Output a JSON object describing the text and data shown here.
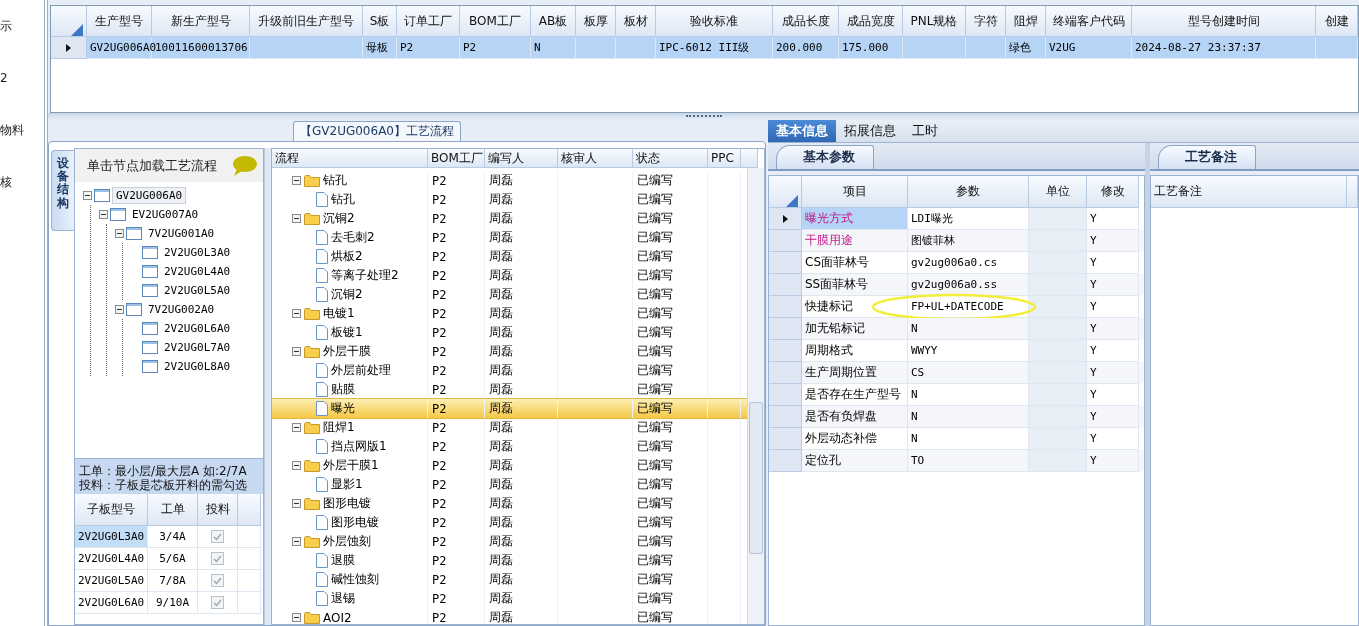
{
  "side_nav": {
    "items": [
      "示",
      "2",
      "物料",
      "核"
    ]
  },
  "product_grid": {
    "columns": [
      "生产型号",
      "新生产型号",
      "升级前旧生产型号",
      "S板",
      "订单工厂",
      "BOM工厂",
      "AB板",
      "板厚",
      "板材",
      "验收标准",
      "成品长度",
      "成品宽度",
      "PNL规格",
      "字符",
      "阻焊",
      "终端客户代码",
      "型号创建时间",
      "创建"
    ],
    "rows": [
      {
        "selected": true,
        "cells": [
          "GV2UG006A0",
          "10011600013706",
          null,
          "母板",
          "P2",
          "P2",
          "N",
          null,
          null,
          "IPC-6012 III级",
          "200.000",
          "175.000",
          null,
          null,
          "绿色",
          "V2UG",
          "2024-08-27 23:37:37",
          null
        ]
      }
    ]
  },
  "flow_panel": {
    "title": "【GV2UG006A0】工艺流程",
    "side_tab": "设备结构",
    "tree_header": "单击节点加载工艺流程",
    "device_tree": [
      {
        "label": "GV2UG006A0",
        "selected": true,
        "expanded": true,
        "children": [
          {
            "label": "EV2UG007A0",
            "selected": false,
            "expanded": true,
            "children": [
              {
                "label": "7V2UG001A0",
                "selected": false,
                "expanded": true,
                "children": [
                  {
                    "label": "2V2UG0L3A0",
                    "selected": false
                  },
                  {
                    "label": "2V2UG0L4A0",
                    "selected": false
                  },
                  {
                    "label": "2V2UG0L5A0",
                    "selected": false
                  }
                ]
              },
              {
                "label": "7V2UG002A0",
                "selected": false,
                "expanded": true,
                "children": [
                  {
                    "label": "2V2UG0L6A0",
                    "selected": false
                  },
                  {
                    "label": "2V2UG0L7A0",
                    "selected": false
                  },
                  {
                    "label": "2V2UG0L8A0",
                    "selected": false
                  }
                ]
              }
            ]
          }
        ]
      }
    ],
    "notes": [
      "工单：最小层/最大层A 如:2/7A",
      "投料：子板是芯板开料的需勾选"
    ],
    "sub_grid": {
      "columns": [
        "子板型号",
        "工单",
        "投料"
      ],
      "rows": [
        {
          "part_no": "2V2UG0L3A0",
          "work_order": "3/4A",
          "checked": true,
          "selected": true
        },
        {
          "part_no": "2V2UG0L4A0",
          "work_order": "5/6A",
          "checked": true,
          "selected": false
        },
        {
          "part_no": "2V2UG0L5A0",
          "work_order": "7/8A",
          "checked": true,
          "selected": false
        },
        {
          "part_no": "2V2UG0L6A0",
          "work_order": "9/10A",
          "checked": true,
          "selected": false
        }
      ]
    },
    "process_grid": {
      "columns": [
        "流程",
        "BOM工厂",
        "编写人",
        "核审人",
        "状态",
        "PPC"
      ],
      "steps": [
        {
          "name": "钻孔",
          "bom_factory": "P2",
          "author": "周磊",
          "status": "已编写",
          "selected": false,
          "expanded": true,
          "children": [
            {
              "name": "钻孔",
              "bom_factory": "P2",
              "author": "周磊",
              "status": "已编写",
              "selected": false
            }
          ]
        },
        {
          "name": "沉铜2",
          "bom_factory": "P2",
          "author": "周磊",
          "status": "已编写",
          "selected": false,
          "expanded": true,
          "children": [
            {
              "name": "去毛刺2",
              "bom_factory": "P2",
              "author": "周磊",
              "status": "已编写",
              "selected": false
            },
            {
              "name": "烘板2",
              "bom_factory": "P2",
              "author": "周磊",
              "status": "已编写",
              "selected": false
            },
            {
              "name": "等离子处理2",
              "bom_factory": "P2",
              "author": "周磊",
              "status": "已编写",
              "selected": false
            },
            {
              "name": "沉铜2",
              "bom_factory": "P2",
              "author": "周磊",
              "status": "已编写",
              "selected": false
            }
          ]
        },
        {
          "name": "电镀1",
          "bom_factory": "P2",
          "author": "周磊",
          "status": "已编写",
          "selected": false,
          "expanded": true,
          "children": [
            {
              "name": "板镀1",
              "bom_factory": "P2",
              "author": "周磊",
              "status": "已编写",
              "selected": false
            }
          ]
        },
        {
          "name": "外层干膜",
          "bom_factory": "P2",
          "author": "周磊",
          "status": "已编写",
          "selected": false,
          "expanded": true,
          "children": [
            {
              "name": "外层前处理",
              "bom_factory": "P2",
              "author": "周磊",
              "status": "已编写",
              "selected": false
            },
            {
              "name": "贴膜",
              "bom_factory": "P2",
              "author": "周磊",
              "status": "已编写",
              "selected": false
            },
            {
              "name": "曝光",
              "bom_factory": "P2",
              "author": "周磊",
              "status": "已编写",
              "selected": true
            }
          ]
        },
        {
          "name": "阻焊1",
          "bom_factory": "P2",
          "author": "周磊",
          "status": "已编写",
          "selected": false,
          "expanded": true,
          "children": [
            {
              "name": "挡点网版1",
              "bom_factory": "P2",
              "author": "周磊",
              "status": "已编写",
              "selected": false
            }
          ]
        },
        {
          "name": "外层干膜1",
          "bom_factory": "P2",
          "author": "周磊",
          "status": "已编写",
          "selected": false,
          "expanded": true,
          "children": [
            {
              "name": "显影1",
              "bom_factory": "P2",
              "author": "周磊",
              "status": "已编写",
              "selected": false
            }
          ]
        },
        {
          "name": "图形电镀",
          "bom_factory": "P2",
          "author": "周磊",
          "status": "已编写",
          "selected": false,
          "expanded": true,
          "children": [
            {
              "name": "图形电镀",
              "bom_factory": "P2",
              "author": "周磊",
              "status": "已编写",
              "selected": false
            }
          ]
        },
        {
          "name": "外层蚀刻",
          "bom_factory": "P2",
          "author": "周磊",
          "status": "已编写",
          "selected": false,
          "expanded": true,
          "children": [
            {
              "name": "退膜",
              "bom_factory": "P2",
              "author": "周磊",
              "status": "已编写",
              "selected": false
            },
            {
              "name": "碱性蚀刻",
              "bom_factory": "P2",
              "author": "周磊",
              "status": "已编写",
              "selected": false
            },
            {
              "name": "退锡",
              "bom_factory": "P2",
              "author": "周磊",
              "status": "已编写",
              "selected": false
            }
          ]
        },
        {
          "name": "AOI2",
          "bom_factory": "P2",
          "author": "周磊",
          "status": "已编写",
          "selected": false,
          "expanded": true
        }
      ]
    }
  },
  "detail_tabs": [
    {
      "label": "基本信息",
      "selected": true
    },
    {
      "label": "拓展信息",
      "selected": false
    },
    {
      "label": "工时",
      "selected": false
    }
  ],
  "basic_params": {
    "tab": "基本参数",
    "columns": [
      "项目",
      "参数",
      "单位",
      "修改"
    ],
    "rows": [
      {
        "item": "曝光方式",
        "highlighted": true,
        "value": "LDI曝光",
        "modified": "Y",
        "selected": true,
        "annotated": false
      },
      {
        "item": "干膜用途",
        "highlighted": true,
        "value": "图镀菲林",
        "modified": "Y",
        "selected": false,
        "annotated": false
      },
      {
        "item": "CS面菲林号",
        "highlighted": false,
        "value": "gv2ug006a0.cs",
        "modified": "Y",
        "selected": false,
        "annotated": false
      },
      {
        "item": "SS面菲林号",
        "highlighted": false,
        "value": "gv2ug006a0.ss",
        "modified": "Y",
        "selected": false,
        "annotated": false
      },
      {
        "item": "快捷标记",
        "highlighted": false,
        "value": "FP+UL+DATECODE",
        "modified": "Y",
        "selected": false,
        "annotated": true
      },
      {
        "item": "加无铅标记",
        "highlighted": false,
        "value": "N",
        "modified": "Y",
        "selected": false,
        "annotated": false
      },
      {
        "item": "周期格式",
        "highlighted": false,
        "value": "WWYY",
        "modified": "Y",
        "selected": false,
        "annotated": false
      },
      {
        "item": "生产周期位置",
        "highlighted": false,
        "value": "CS",
        "modified": "Y",
        "selected": false,
        "annotated": false
      },
      {
        "item": "是否存在生产型号",
        "highlighted": false,
        "value": "N",
        "modified": "Y",
        "selected": false,
        "annotated": false
      },
      {
        "item": "是否有负焊盘",
        "highlighted": false,
        "value": "N",
        "modified": "Y",
        "selected": false,
        "annotated": false
      },
      {
        "item": "外层动态补偿",
        "highlighted": false,
        "value": "N",
        "modified": "Y",
        "selected": false,
        "annotated": false
      },
      {
        "item": "定位孔",
        "highlighted": false,
        "value": "TO",
        "modified": "Y",
        "selected": false,
        "annotated": false
      }
    ]
  },
  "process_notes": {
    "tab": "工艺备注",
    "columns": [
      "工艺备注"
    ]
  }
}
